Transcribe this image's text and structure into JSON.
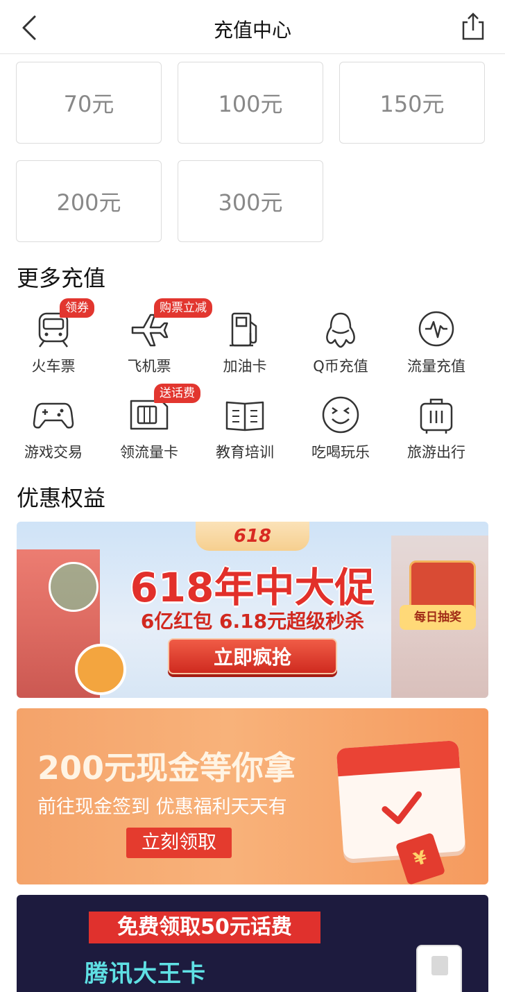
{
  "header": {
    "title": "充值中心",
    "back_icon": "chevron-left-icon",
    "share_icon": "share-icon"
  },
  "amounts": [
    "70元",
    "100元",
    "150元",
    "200元",
    "300元"
  ],
  "more_recharge": {
    "title": "更多充值",
    "items": [
      {
        "label": "火车票",
        "icon": "train-icon",
        "tag": "领券"
      },
      {
        "label": "飞机票",
        "icon": "airplane-icon",
        "tag": "购票立减"
      },
      {
        "label": "加油卡",
        "icon": "fuel-pump-icon",
        "tag": ""
      },
      {
        "label": "Q币充值",
        "icon": "penguin-icon",
        "tag": ""
      },
      {
        "label": "流量充值",
        "icon": "data-pulse-icon",
        "tag": ""
      },
      {
        "label": "游戏交易",
        "icon": "gamepad-icon",
        "tag": ""
      },
      {
        "label": "领流量卡",
        "icon": "sim-card-icon",
        "tag": "送话费"
      },
      {
        "label": "教育培训",
        "icon": "book-icon",
        "tag": ""
      },
      {
        "label": "吃喝玩乐",
        "icon": "smile-face-icon",
        "tag": ""
      },
      {
        "label": "旅游出行",
        "icon": "suitcase-icon",
        "tag": ""
      }
    ]
  },
  "benefits": {
    "title": "优惠权益",
    "banner1": {
      "badge": "618",
      "headline": "618年中大促",
      "sub": "6亿红包  6.18元超级秒杀",
      "cta": "立即疯抢",
      "side_label": "每日抽奖"
    },
    "banner2": {
      "headline": "200元现金等你拿",
      "sub": "前往现金签到 优惠福利天天有",
      "cta": "立刻领取"
    },
    "banner3": {
      "headline": "免费领取50元话费",
      "brand": "腾讯大王卡"
    }
  },
  "colors": {
    "accent_red": "#e2362f",
    "text_dark": "#111111",
    "tile_text": "#888888"
  }
}
